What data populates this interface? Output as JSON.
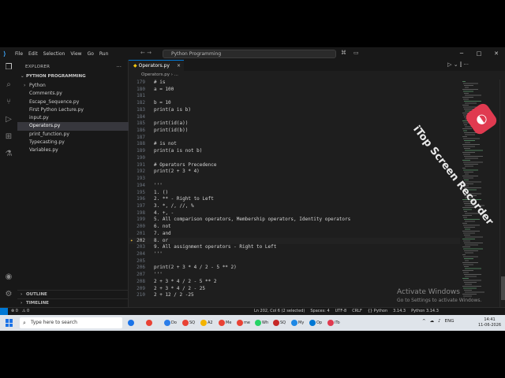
{
  "menu": [
    "File",
    "Edit",
    "Selection",
    "View",
    "Go",
    "Run"
  ],
  "titlebar": {
    "search": "Python Programming"
  },
  "sidebar": {
    "header": "EXPLORER",
    "project": "PYTHON PROGRAMMING",
    "items": [
      {
        "label": "Python",
        "folder": true
      },
      {
        "label": "Comments.py"
      },
      {
        "label": "Escape_Sequence.py"
      },
      {
        "label": "First Python Lecture.py"
      },
      {
        "label": "input.py"
      },
      {
        "label": "Operators.py",
        "active": true
      },
      {
        "label": "print_function.py"
      },
      {
        "label": "Typecasting.py"
      },
      {
        "label": "Variables.py"
      }
    ],
    "outline": "OUTLINE",
    "timeline": "TIMELINE"
  },
  "tab": {
    "label": "Operators.py"
  },
  "breadcrumb": "Operators.py › ...",
  "code": [
    {
      "n": "179",
      "t": "# is"
    },
    {
      "n": "180",
      "t": "a = 100"
    },
    {
      "n": "181",
      "t": ""
    },
    {
      "n": "182",
      "t": "b = 10"
    },
    {
      "n": "183",
      "t": "print(a is b)"
    },
    {
      "n": "184",
      "t": ""
    },
    {
      "n": "185",
      "t": "print(id(a))"
    },
    {
      "n": "186",
      "t": "print(id(b))"
    },
    {
      "n": "187",
      "t": ""
    },
    {
      "n": "188",
      "t": "# is not"
    },
    {
      "n": "189",
      "t": "print(a is not b)"
    },
    {
      "n": "190",
      "t": ""
    },
    {
      "n": "191",
      "t": "# Operators Precedence"
    },
    {
      "n": "192",
      "t": "print(2 + 3 * 4)"
    },
    {
      "n": "193",
      "t": ""
    },
    {
      "n": "194",
      "t": "'''"
    },
    {
      "n": "195",
      "t": "1. ()"
    },
    {
      "n": "196",
      "t": "2. ** - Right to Left"
    },
    {
      "n": "197",
      "t": "3. *, /, //, %"
    },
    {
      "n": "198",
      "t": "4. +, -"
    },
    {
      "n": "199",
      "t": "5. All comparison operators, Membership operators, Identity operators"
    },
    {
      "n": "200",
      "t": "6. not"
    },
    {
      "n": "201",
      "t": "7. and"
    },
    {
      "n": "202",
      "t": "8. or",
      "current": true
    },
    {
      "n": "203",
      "t": "9. All assignment operators - Right to Left"
    },
    {
      "n": "204",
      "t": "'''"
    },
    {
      "n": "205",
      "t": ""
    },
    {
      "n": "206",
      "t": "print(2 + 3 * 4 / 2 - 5 ** 2)"
    },
    {
      "n": "207",
      "t": "'''"
    },
    {
      "n": "208",
      "t": "2 + 3 * 4 / 2 - 5 ** 2"
    },
    {
      "n": "209",
      "t": "2 + 3 * 4 / 2 - 25"
    },
    {
      "n": "210",
      "t": "2 + 12 / 2 -25"
    }
  ],
  "activation": {
    "title": "Activate Windows",
    "subtitle": "Go to Settings to activate Windows."
  },
  "status": {
    "left": [
      "⊗ 0",
      "⚠ 0"
    ],
    "right": [
      "Ln 202, Col 6 (2 selected)",
      "Spaces: 4",
      "UTF-8",
      "CRLF",
      "{} Python",
      "3.14.3",
      "Python 3.14.3"
    ]
  },
  "taskbar": {
    "search_placeholder": "Type here to search",
    "apps": [
      {
        "label": "",
        "color": "#1a73e8"
      },
      {
        "label": "",
        "color": "#e94235"
      },
      {
        "label": "Do",
        "color": "#2b7de9"
      },
      {
        "label": "SQ",
        "color": "#e94235"
      },
      {
        "label": "A2",
        "color": "#f4b400"
      },
      {
        "label": "Me",
        "color": "#e94235"
      },
      {
        "label": "me",
        "color": "#e94235"
      },
      {
        "label": "Wh",
        "color": "#25d366"
      },
      {
        "label": "SQ",
        "color": "#c62828"
      },
      {
        "label": "My",
        "color": "#1e88e5"
      },
      {
        "label": "Op",
        "color": "#0078d4"
      },
      {
        "label": "iTo",
        "color": "#e03a50"
      }
    ],
    "tray": [
      "^",
      "ENG"
    ],
    "time": "14:41",
    "date": "11-06-2026"
  },
  "watermark": "iTop Screen Recorder"
}
